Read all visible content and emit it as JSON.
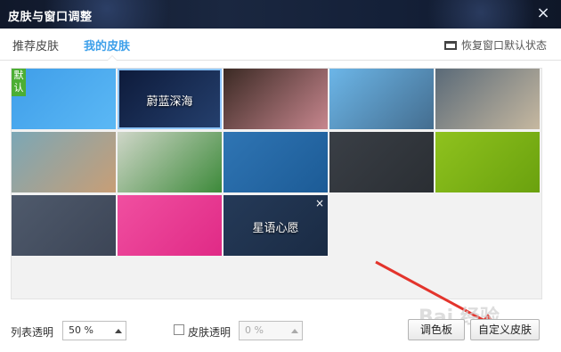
{
  "window": {
    "title": "皮肤与窗口调整",
    "close_icon": "×"
  },
  "tabs": [
    {
      "label": "推荐皮肤",
      "active": false
    },
    {
      "label": "我的皮肤",
      "active": true
    }
  ],
  "restore_default": "恢复窗口默认状态",
  "skins": [
    {
      "label": "",
      "badge": "默认",
      "colors": [
        "#3f9ee9",
        "#5bb8f5"
      ]
    },
    {
      "label": "蔚蓝深海",
      "colors": [
        "#0d1a3a",
        "#25406e"
      ],
      "selected": true
    },
    {
      "label": "",
      "colors": [
        "#3b2a24",
        "#c7868e"
      ]
    },
    {
      "label": "",
      "colors": [
        "#6cb6e8",
        "#446d8f"
      ]
    },
    {
      "label": "",
      "colors": [
        "#5a6a78",
        "#c6b8a0"
      ]
    },
    {
      "label": "",
      "colors": [
        "#7ba7b6",
        "#c89e76"
      ]
    },
    {
      "label": "",
      "colors": [
        "#cfd6c8",
        "#3d8a3a"
      ]
    },
    {
      "label": "",
      "colors": [
        "#2f75b4",
        "#1c5b96"
      ]
    },
    {
      "label": "",
      "colors": [
        "#3a3f46",
        "#2a2e33"
      ]
    },
    {
      "label": "",
      "colors": [
        "#8fc21e",
        "#6aa10e"
      ]
    },
    {
      "label": "",
      "colors": [
        "#4f5a6c",
        "#3c4556"
      ]
    },
    {
      "label": "",
      "colors": [
        "#f04fa0",
        "#e02a86"
      ]
    },
    {
      "label": "星语心愿",
      "colors": [
        "#253a58",
        "#1a2b44"
      ],
      "deletable": true,
      "delete_icon": "×"
    }
  ],
  "bottom": {
    "list_opacity_label": "列表透明",
    "list_opacity_value": "50 %",
    "skin_opacity_label": "皮肤透明",
    "skin_opacity_checked": false,
    "skin_opacity_value": "0 %",
    "palette_button": "调色板",
    "custom_skin_button": "自定义皮肤"
  },
  "watermark": "Bai 经验"
}
